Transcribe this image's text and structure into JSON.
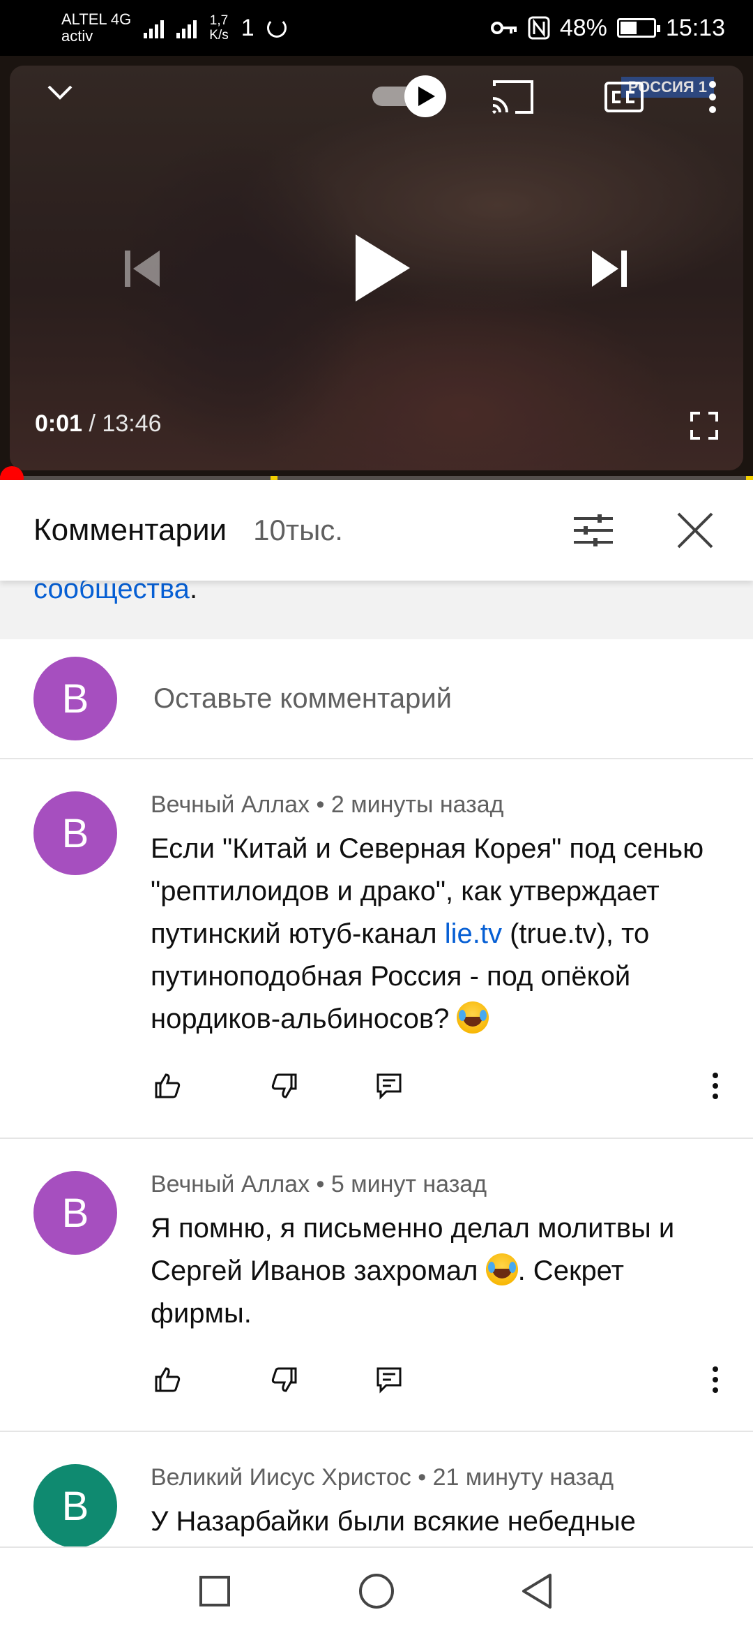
{
  "status_bar": {
    "carrier_line1": "ALTEL 4G",
    "carrier_line2": "activ",
    "net_type": "4G",
    "speed_value": "1,7",
    "speed_unit": "K/s",
    "extra": "1",
    "battery_percent": "48%",
    "battery_level": 0.48,
    "time": "15:13"
  },
  "player": {
    "channel_logo": "РОССИЯ 1",
    "time_current": "0:01",
    "time_separator": "/",
    "time_total": "13:46",
    "progress_fraction": 0.0012
  },
  "comments_header": {
    "title": "Комментарии",
    "count": "10тыс."
  },
  "info_strip": {
    "link_text": "сообщества",
    "trailing": "."
  },
  "add_comment": {
    "avatar_letter": "В",
    "placeholder": "Оставьте комментарий"
  },
  "comments": [
    {
      "avatar_letter": "В",
      "author": "Вечный Аллах",
      "time": "2 минуты назад",
      "text_part1": "Если \"Китай и Северная Корея\" под сенью \"рептилоидов и драко\", как утверждает путинский ютуб-канал ",
      "link": "lie.tv",
      "text_part2": " (true.tv), то путиноподобная Россия - под опёкой нордиков-альбиносов? "
    },
    {
      "avatar_letter": "В",
      "author": "Вечный Аллах",
      "time": "5 минут назад",
      "text_part1": "Я помню, я письменно делал молитвы и Сергей Иванов захромал ",
      "text_part2": ". Секрет фирмы."
    },
    {
      "avatar_letter": "В",
      "author": "Великий Иисус Христос",
      "time": "21 минуту назад",
      "text_part1": "У Назарбайки были всякие небедные"
    }
  ],
  "meta_separator": " • ",
  "icons": {
    "minimize": "chevron-down-icon",
    "autoplay": "autoplay-toggle-icon",
    "cast": "cast-icon",
    "captions": "cc-icon",
    "more": "more-vert-icon",
    "prev": "skip-previous-icon",
    "play": "play-icon",
    "next": "skip-next-icon",
    "fullscreen": "fullscreen-icon",
    "sort": "sort-icon",
    "close": "close-icon",
    "like": "thumb-up-icon",
    "dislike": "thumb-down-icon",
    "reply": "reply-icon",
    "nav_recent": "square-icon",
    "nav_home": "circle-icon",
    "nav_back": "triangle-back-icon"
  }
}
